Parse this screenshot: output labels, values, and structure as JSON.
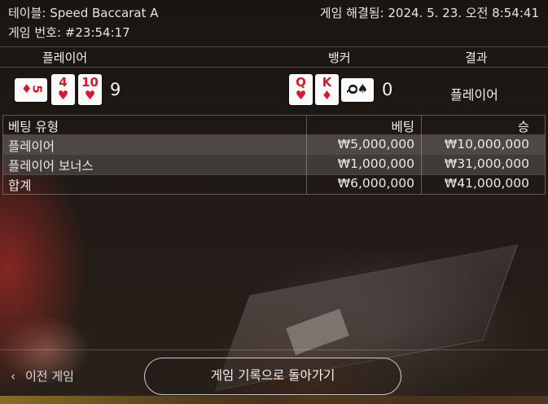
{
  "header": {
    "table": "테이블: Speed Baccarat A",
    "round": "게임 번호: #23:54:17",
    "settled": "게임 해결됨: 2024. 5. 23. 오전 8:54:41"
  },
  "result": {
    "player_label": "플레이어",
    "banker_label": "뱅커",
    "result_label": "결과",
    "player_cards": [
      {
        "rank": "5",
        "suit": "♦",
        "color": "red"
      },
      {
        "rank": "4",
        "suit": "♥",
        "color": "red"
      },
      {
        "rank": "10",
        "suit": "♥",
        "color": "red"
      }
    ],
    "player_score": "9",
    "banker_cards": [
      {
        "rank": "Q",
        "suit": "♥",
        "color": "red"
      },
      {
        "rank": "K",
        "suit": "♦",
        "color": "red"
      },
      {
        "rank": "Q",
        "suit": "♠",
        "color": "black"
      }
    ],
    "banker_score": "0",
    "outcome": "플레이어"
  },
  "bets": {
    "headers": [
      "베팅 유형",
      "베팅",
      "승"
    ],
    "rows": [
      {
        "type": "플레이어",
        "bet": "₩5,000,000",
        "win": "₩10,000,000"
      },
      {
        "type": "플레이어 보너스",
        "bet": "₩1,000,000",
        "win": "₩31,000,000"
      }
    ],
    "total": {
      "type": "합계",
      "bet": "₩6,000,000",
      "win": "₩41,000,000"
    }
  },
  "footer": {
    "prev_label": "이전 게임",
    "back_label": "게임 기록으로 돌아가기"
  },
  "icons": {
    "prev": "chevron-left-icon"
  }
}
